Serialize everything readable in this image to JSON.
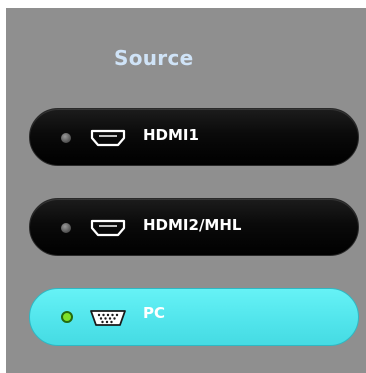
{
  "title": "Source",
  "sources": [
    {
      "label": "HDMI1",
      "icon": "hdmi-port-icon",
      "state": "inactive",
      "selected": false
    },
    {
      "label": "HDMI2/MHL",
      "icon": "hdmi-port-icon",
      "state": "inactive",
      "selected": false
    },
    {
      "label": "PC",
      "icon": "vga-port-icon",
      "state": "active",
      "selected": true
    }
  ],
  "colors": {
    "panel_bg": "#8f8f8f",
    "title": "#cfe3f7",
    "inactive_button": "#000000",
    "active_button": "#52e5ec",
    "active_led": "#7ee12a",
    "inactive_led": "#5a5a5a"
  }
}
